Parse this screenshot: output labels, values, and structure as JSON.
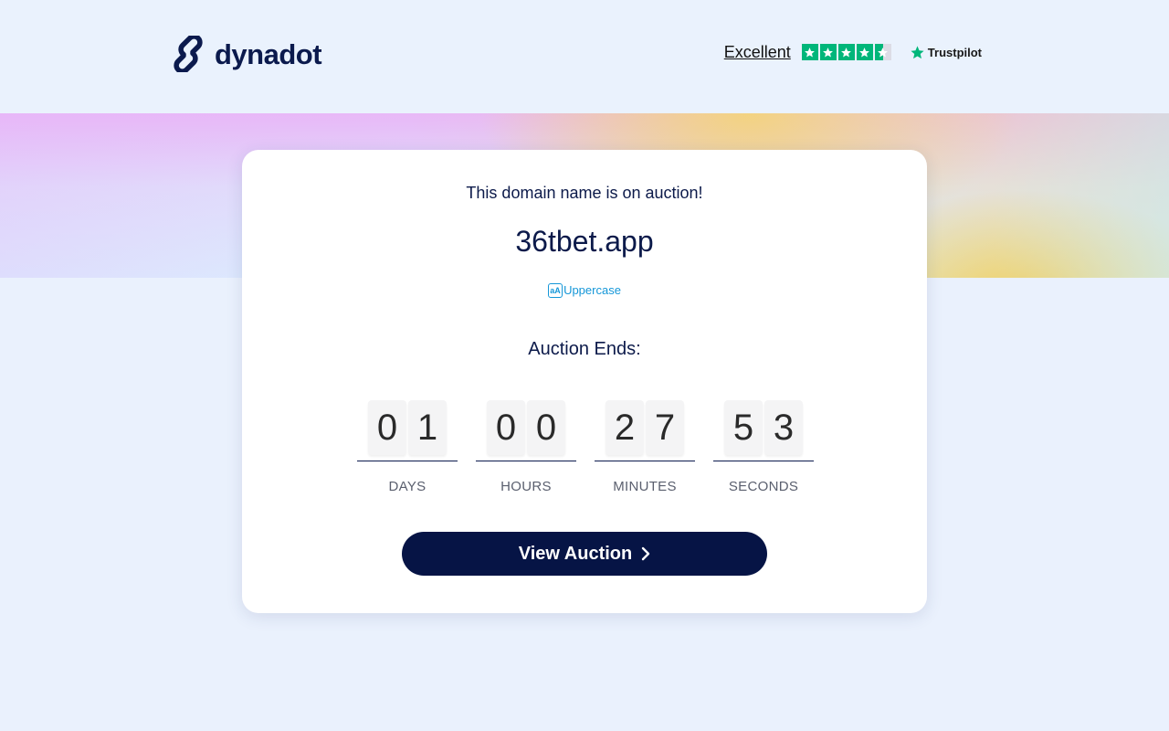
{
  "header": {
    "logo_text": "dynadot",
    "trust": {
      "rating_label": "Excellent",
      "stars_filled": 4.5,
      "stars_total": 5,
      "brand": "Trustpilot",
      "star_color": "#00b67a"
    }
  },
  "auction": {
    "notice": "This domain name is on auction!",
    "domain": "36tbet.app",
    "case_toggle_label": "Uppercase",
    "case_toggle_icon_text": "aA",
    "ends_label": "Auction Ends:",
    "countdown": [
      {
        "digits": [
          "0",
          "1"
        ],
        "label": "DAYS"
      },
      {
        "digits": [
          "0",
          "0"
        ],
        "label": "HOURS"
      },
      {
        "digits": [
          "2",
          "7"
        ],
        "label": "MINUTES"
      },
      {
        "digits": [
          "5",
          "3"
        ],
        "label": "SECONDS"
      }
    ],
    "button_label": "View Auction"
  },
  "colors": {
    "navy": "#061445",
    "link_blue": "#1597d8",
    "page_bg": "#eaf1fd"
  },
  "icons": {
    "logo": "chain-link-icon",
    "button": "chevron-right-icon",
    "case_toggle": "text-case-icon",
    "trust_star": "star-icon"
  }
}
